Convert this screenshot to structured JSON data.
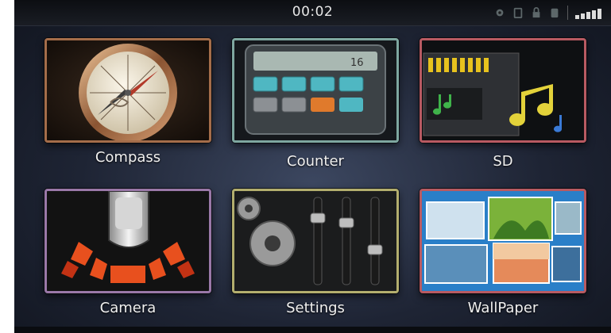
{
  "status_bar": {
    "time": "00:02",
    "icons": [
      "gear-icon",
      "battery-icon",
      "lock-icon",
      "storage-icon"
    ],
    "signal_bars": 5
  },
  "apps": [
    {
      "label": "Compass",
      "icon": "compass-icon",
      "border_color": "#a46d4a"
    },
    {
      "label": "Counter",
      "icon": "calculator-icon",
      "border_color": "#7ea7a0",
      "display_value": "16"
    },
    {
      "label": "SD",
      "icon": "sd-card-music-icon",
      "border_color": "#b85a62"
    },
    {
      "label": "Camera",
      "icon": "parking-camera-icon",
      "border_color": "#9a78a8"
    },
    {
      "label": "Settings",
      "icon": "gears-sliders-icon",
      "border_color": "#b3ae6e"
    },
    {
      "label": "WallPaper",
      "icon": "wallpaper-icon",
      "border_color": "#b85a62"
    }
  ]
}
